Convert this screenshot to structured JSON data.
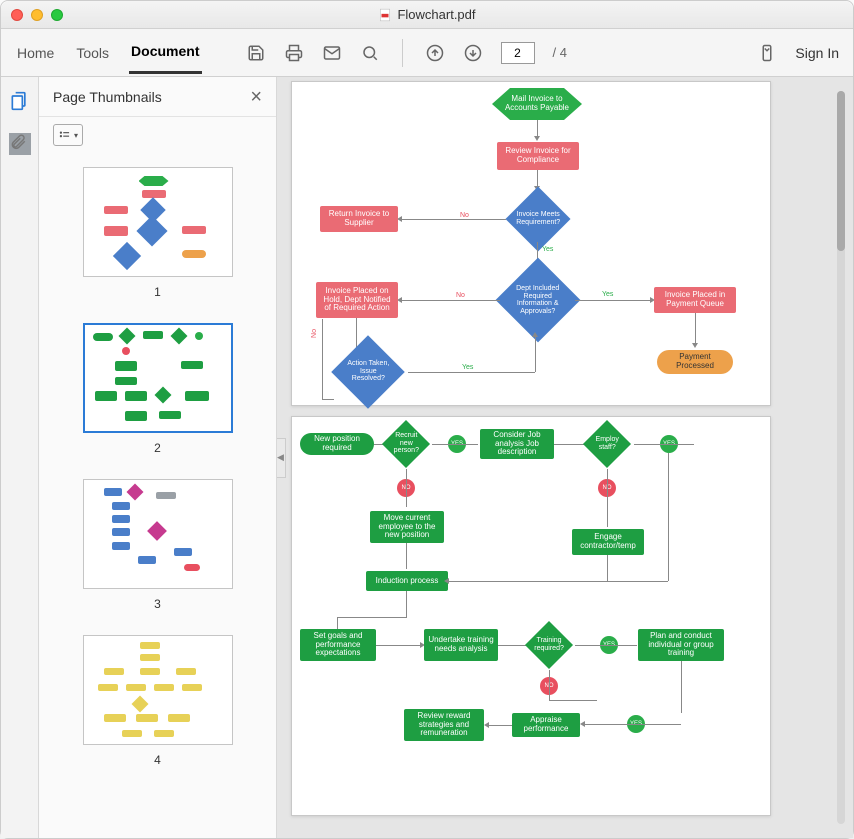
{
  "window": {
    "title": "Flowchart.pdf"
  },
  "toolbar": {
    "home": "Home",
    "tools": "Tools",
    "document": "Document",
    "page_current": "2",
    "page_total": "/ 4",
    "sign_in": "Sign In"
  },
  "thumbs": {
    "header": "Page Thumbnails",
    "pages": [
      "1",
      "2",
      "3",
      "4"
    ]
  },
  "chart1": {
    "hex1": "Mail Invoice to\nAccounts Payable",
    "r1": "Review Invoice\nfor Compliance",
    "d1": "Invoice Meets\nRequirement?",
    "r2": "Return Invoice to\nSupplier",
    "d2": "Dept Included\nRequired Information &\nApprovals?",
    "r3": "Invoice Placed on\nHold, Dept Notified\nof Required Action",
    "r4": "Invoice Placed in\nPayment Queue",
    "d3": "Action Taken,\nIssue Resolved?",
    "t1": "Payment\nProcessed",
    "yes": "Yes",
    "no": "No"
  },
  "chart2": {
    "t1": "New position\nrequired",
    "d1": "Recruit new\nperson?",
    "r1": "Consider\nJob analysis\nJob description",
    "d2": "Employ staff?",
    "r2": "Move current\nemployee to the\nnew position",
    "r3": "Engage\ncontractor/temp",
    "r4": "Induction process",
    "r5": "Set goals and\nperformance\nexpectations",
    "r6": "Undertake\ntraining needs\nanalysis",
    "d3": "Training\nrequired?",
    "r7": "Plan and conduct\nindividual or\ngroup training",
    "r8": "Review reward\nstrategies and\nremuneration",
    "r9": "Appraise\nperformance",
    "yes": "YES",
    "no": "NO"
  }
}
